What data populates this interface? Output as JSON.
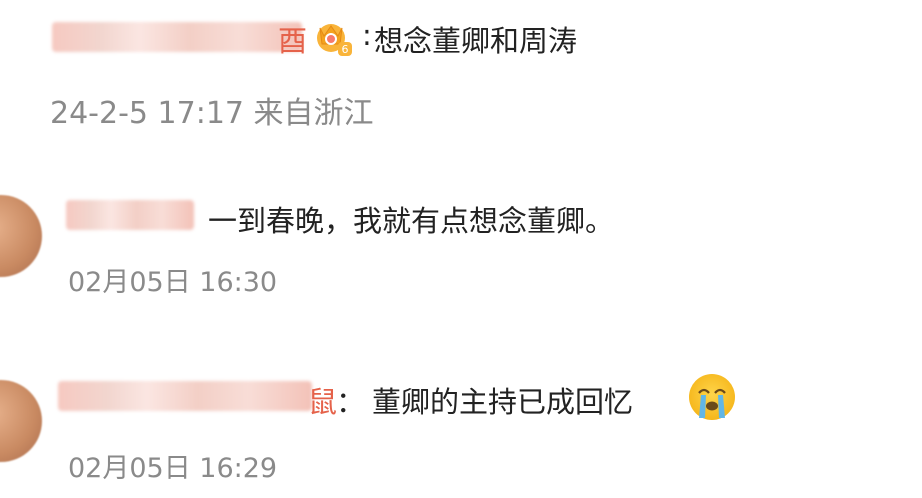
{
  "post": {
    "name_tail": "酉",
    "separator": ":",
    "content": "想念董卿和周涛",
    "meta": "24-2-5 17:17 来自浙江",
    "vip_badge_icon": "crown-badge-icon",
    "vip_level": "6"
  },
  "comments": [
    {
      "name_tail": "",
      "content": "一到春晚，我就有点想念董卿。",
      "time": "02月05日 16:30",
      "avatar_icon": "user-avatar"
    },
    {
      "name_tail": "鼠",
      "separator": "：",
      "content": "董卿的主持已成回忆",
      "emoji_icon": "crying-face-icon",
      "time": "02月05日 16:29",
      "avatar_icon": "user-avatar"
    }
  ]
}
